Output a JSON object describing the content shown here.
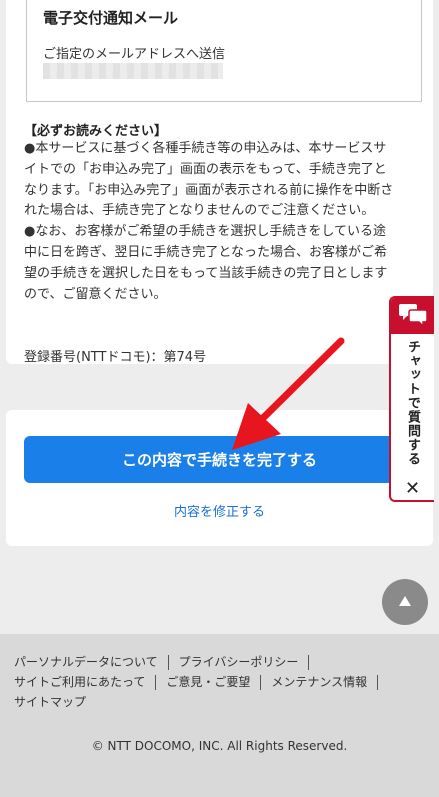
{
  "notice_box": {
    "title": "電子交付通知メール",
    "description": "ご指定のメールアドレスへ送信"
  },
  "important_notice": {
    "heading": "【必ずお読みください】",
    "paragraphs": [
      "●本サービスに基づく各種手続き等の申込みは、本サービスサイトでの「お申込み完了」画面の表示をもって、手続き完了となります。「お申込み完了」画面が表示される前に操作を中断された場合は、手続き完了となりませんのでご注意ください。",
      "●なお、お客様がご希望の手続きを選択し手続きをしている途中に日を跨ぎ、翌日に手続き完了となった場合、お客様がご希望の手続きを選択した日をもって当該手続きの完了日としますので、ご留意ください。"
    ],
    "registration": "登録番号(NTTドコモ)：第74号"
  },
  "actions": {
    "complete_label": "この内容で手続きを完了する",
    "modify_label": "内容を修正する"
  },
  "chat": {
    "label": "チャットで質問する",
    "close": "✕"
  },
  "footer": {
    "links": {
      "personal_data": "パーソナルデータについて",
      "privacy_policy": "プライバシーポリシー",
      "site_terms": "サイトご利用にあたって",
      "feedback": "ご意見・ご要望",
      "maintenance": "メンテナンス情報",
      "sitemap": "サイトマップ"
    },
    "copyright": "© NTT DOCOMO, INC. All Rights Reserved."
  },
  "colors": {
    "primary_button": "#1a7fe8",
    "link": "#1a6fd6",
    "chat_accent": "#c8102e",
    "annotation_arrow": "#e8141e"
  },
  "icons": {
    "chat": "chat-bubbles-icon",
    "close": "close-icon",
    "scroll_top": "triangle-up-icon"
  }
}
